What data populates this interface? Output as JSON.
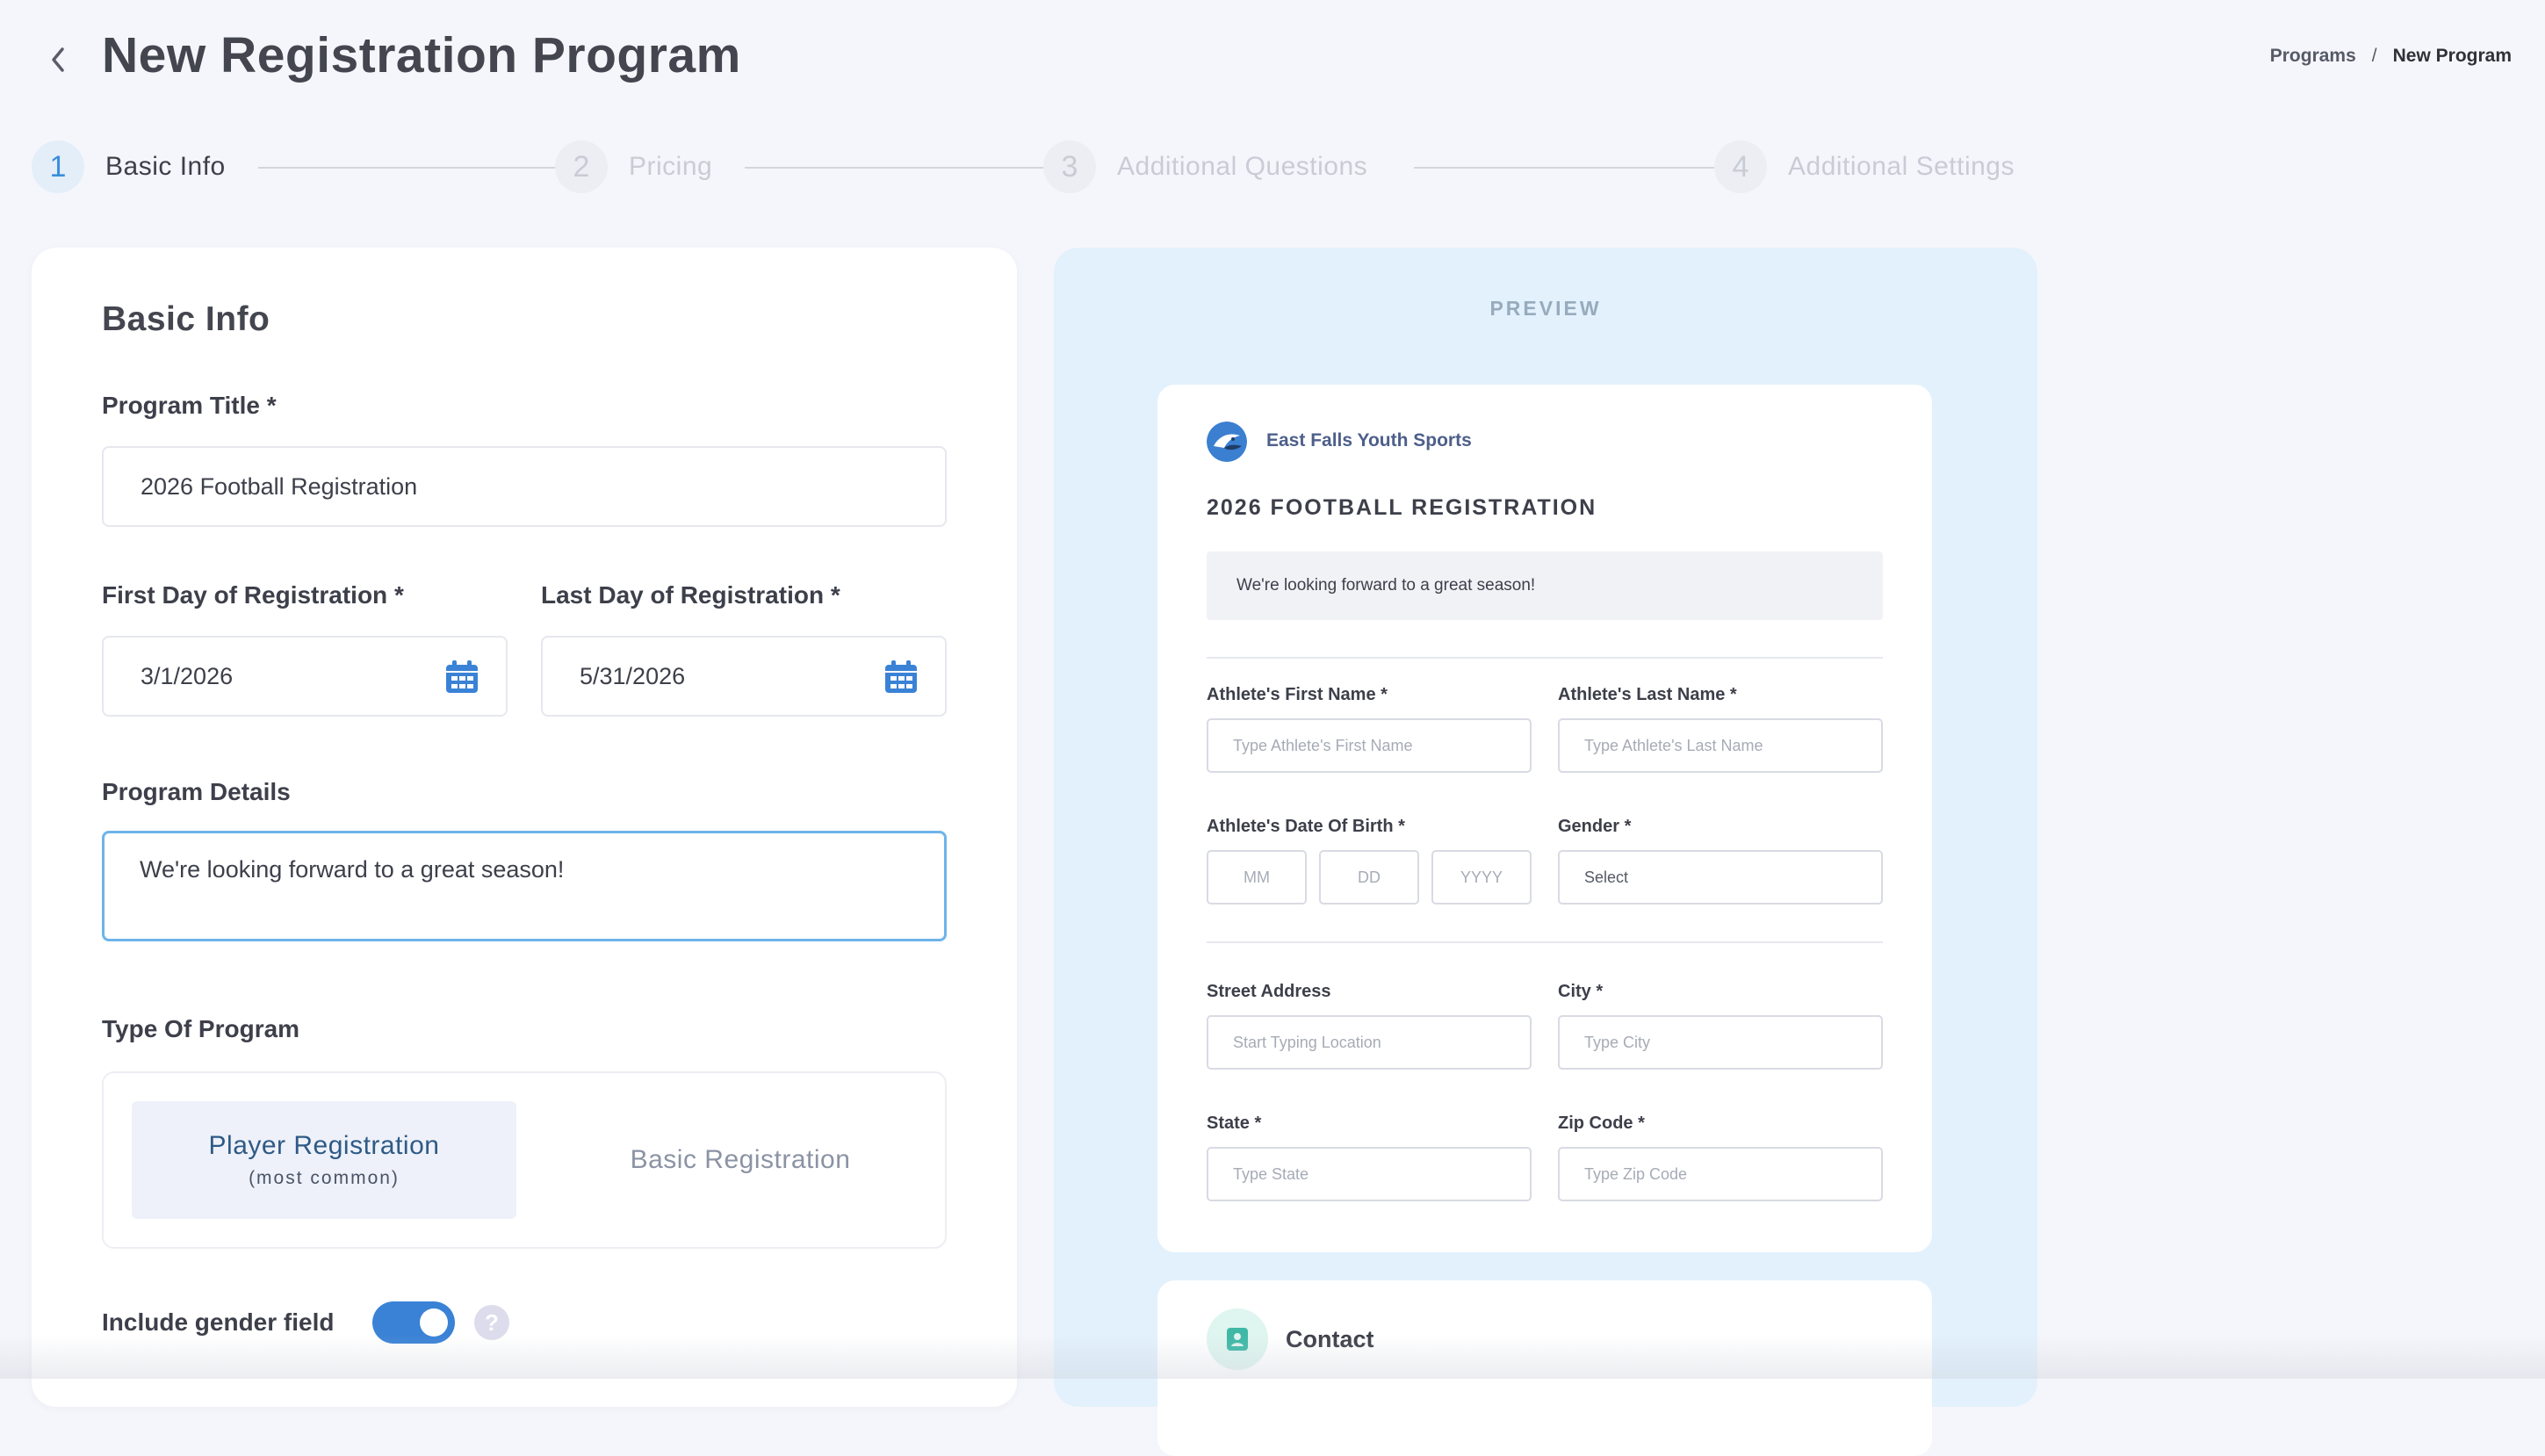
{
  "header": {
    "title": "New Registration Program",
    "breadcrumb": {
      "parent": "Programs",
      "separator": "/",
      "current": "New Program"
    }
  },
  "stepper": {
    "steps": [
      {
        "number": "1",
        "label": "Basic Info",
        "state": "active"
      },
      {
        "number": "2",
        "label": "Pricing",
        "state": "inactive"
      },
      {
        "number": "3",
        "label": "Additional Questions",
        "state": "inactive"
      },
      {
        "number": "4",
        "label": "Additional Settings",
        "state": "inactive"
      }
    ]
  },
  "form": {
    "card_title": "Basic Info",
    "program_title_label": "Program Title *",
    "program_title_value": "2026 Football Registration",
    "first_day_label": "First Day of Registration *",
    "first_day_value": "3/1/2026",
    "last_day_label": "Last Day of Registration *",
    "last_day_value": "5/31/2026",
    "details_label": "Program Details",
    "details_value": "We're looking forward to a great season!",
    "type_label": "Type Of Program",
    "type_options": [
      {
        "label": "Player Registration",
        "sublabel": "(most common)",
        "selected": true
      },
      {
        "label": "Basic Registration",
        "selected": false
      }
    ],
    "gender_toggle_label": "Include gender field",
    "gender_toggle_on": true,
    "help_glyph": "?"
  },
  "preview": {
    "label": "PREVIEW",
    "org_name": "East Falls Youth Sports",
    "title": "2026 FOOTBALL REGISTRATION",
    "description": "We're looking forward to a great season!",
    "fields": {
      "first_name_label": "Athlete's First Name *",
      "first_name_placeholder": "Type Athlete's First Name",
      "last_name_label": "Athlete's Last Name *",
      "last_name_placeholder": "Type Athlete's Last Name",
      "dob_label": "Athlete's Date Of Birth *",
      "dob_mm": "MM",
      "dob_dd": "DD",
      "dob_yyyy": "YYYY",
      "gender_label": "Gender *",
      "gender_placeholder": "Select",
      "street_label": "Street Address",
      "street_placeholder": "Start Typing Location",
      "city_label": "City *",
      "city_placeholder": "Type City",
      "state_label": "State *",
      "state_placeholder": "Type State",
      "zip_label": "Zip Code *",
      "zip_placeholder": "Type Zip Code"
    },
    "contact_title": "Contact"
  },
  "colors": {
    "accent": "#3a82d6",
    "preview_bg": "#e2f1fc",
    "page_bg": "#f5f6fb"
  },
  "icons": {
    "back": "chevron-left-icon",
    "calendar": "calendar-icon",
    "help": "question-icon",
    "contact": "contact-card-icon"
  }
}
